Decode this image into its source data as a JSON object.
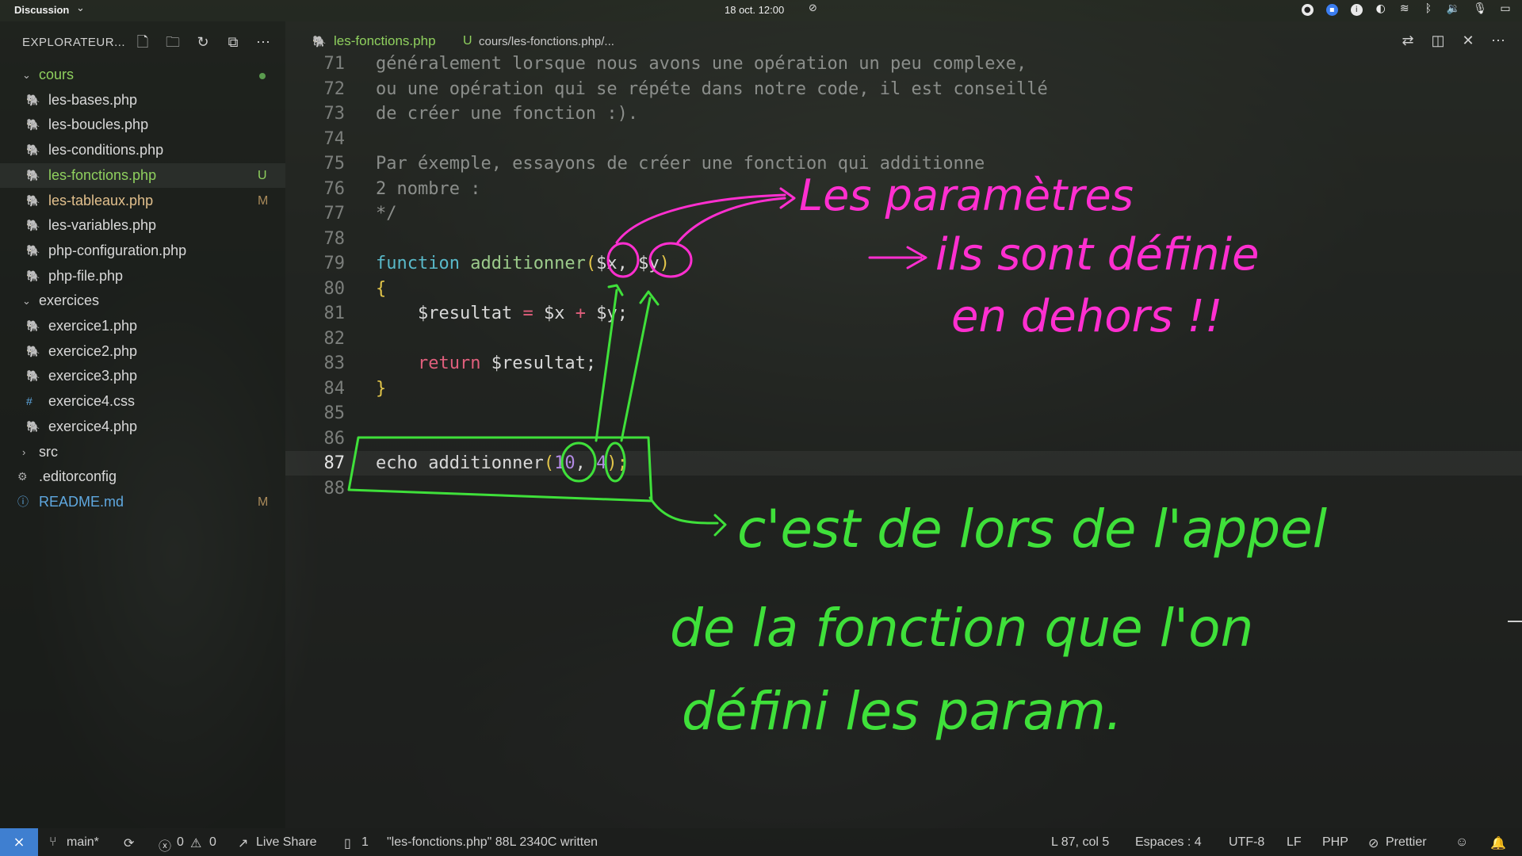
{
  "system_bar": {
    "app_name": "Discussion",
    "datetime": "18 oct.  12:00"
  },
  "sidebar": {
    "title": "EXPLORATEUR...",
    "tree": [
      {
        "type": "folder",
        "name": "cours",
        "open": true
      },
      {
        "type": "file",
        "name": "les-bases.php"
      },
      {
        "type": "file",
        "name": "les-boucles.php"
      },
      {
        "type": "file",
        "name": "les-conditions.php"
      },
      {
        "type": "file",
        "name": "les-fonctions.php",
        "badge": "U"
      },
      {
        "type": "file",
        "name": "les-tableaux.php",
        "badge": "M"
      },
      {
        "type": "file",
        "name": "les-variables.php"
      },
      {
        "type": "file",
        "name": "php-configuration.php"
      },
      {
        "type": "file",
        "name": "php-file.php"
      },
      {
        "type": "folder",
        "name": "exercices",
        "open": true
      },
      {
        "type": "file",
        "name": "exercice1.php"
      },
      {
        "type": "file",
        "name": "exercice2.php"
      },
      {
        "type": "file",
        "name": "exercice3.php"
      },
      {
        "type": "file",
        "name": "exercice4.css"
      },
      {
        "type": "file",
        "name": "exercice4.php"
      },
      {
        "type": "folder",
        "name": "src",
        "open": false
      },
      {
        "type": "file",
        "name": ".editorconfig"
      },
      {
        "type": "file",
        "name": "README.md",
        "badge": "M"
      }
    ]
  },
  "editor": {
    "tab": {
      "name": "les-fonctions.php",
      "badge": "U",
      "path": "cours/les-fonctions.php/..."
    },
    "line_numbers": [
      "71",
      "72",
      "73",
      "74",
      "75",
      "76",
      "77",
      "78",
      "79",
      "80",
      "81",
      "82",
      "83",
      "84",
      "85",
      "86",
      "87",
      "88"
    ],
    "code": {
      "l71": "généralement lorsque nous avons une opération un peu complexe,",
      "l72": "ou une opération qui se répéte dans notre code, il est conseillé",
      "l73": "de créer une fonction :).",
      "l75": "Par éxemple, essayons de créer une fonction qui additionne",
      "l76": "2 nombre :",
      "l77": "*/",
      "l79_kw": "function",
      "l79_fn": "additionner",
      "l79_open": "(",
      "l79_x": "$x",
      "l79_comma": ", ",
      "l79_y": "$y",
      "l79_close": ")",
      "l80": "{",
      "l81_a": "$resultat",
      "l81_eq": " = ",
      "l81_b": "$x",
      "l81_plus": " + ",
      "l81_c": "$y;",
      "l83_kw": "return",
      "l83_var": " $resultat;",
      "l84": "}",
      "l87_a": "echo additionner",
      "l87_open": "(",
      "l87_n1": "10",
      "l87_comma": ", ",
      "l87_n2": "4",
      "l87_close": ");"
    }
  },
  "annotations": {
    "pink_line1": "Les paramètres",
    "pink_line2": "ils sont définie",
    "pink_line3": "en dehors !!",
    "green_line1": "c'est de lors de l'appel",
    "green_line2": "de la fonction que l'on",
    "green_line3": "défini les param.",
    "pink_color": "#ff2fd0",
    "green_color": "#3fe03a"
  },
  "statusbar": {
    "branch": "main*",
    "errors": "0",
    "warnings": "0",
    "live_share": "Live Share",
    "ports": "1",
    "message": "\"les-fonctions.php\" 88L 2340C written",
    "position": "L 87, col 5",
    "spaces": "Espaces : 4",
    "encoding": "UTF-8",
    "eol": "LF",
    "language": "PHP",
    "formatter": "Prettier"
  },
  "colors": {
    "accent": "#3f7fd0",
    "untracked": "#8fd05e",
    "modified": "#e2c08d",
    "keyword": "#59b9c9",
    "function": "#9ccb8b",
    "operator": "#e05f7c",
    "number": "#b28ae3"
  }
}
